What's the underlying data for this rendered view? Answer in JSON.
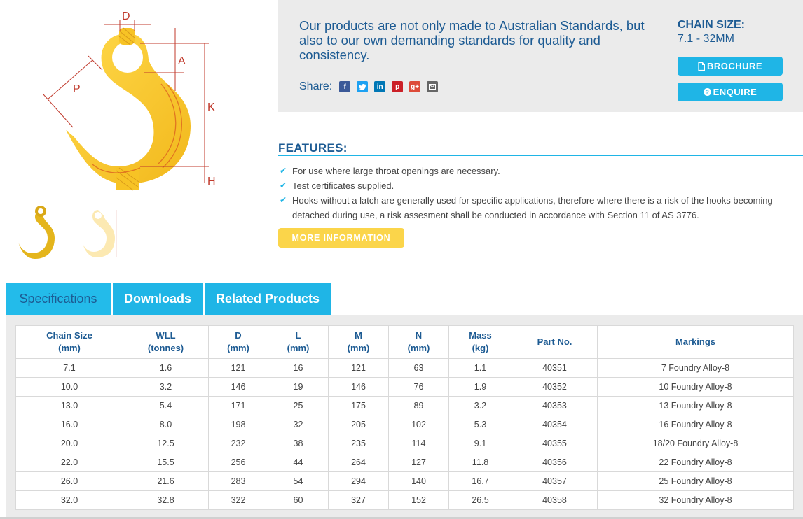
{
  "diagram": {
    "labels": {
      "d": "D",
      "a": "A",
      "p": "P",
      "k": "K",
      "h": "H"
    }
  },
  "info": {
    "intro": "Our products are not only made to Australian Standards, but also to our own demanding standards for quality and consistency.",
    "share_label": "Share:",
    "share_icons": [
      "facebook-icon",
      "twitter-icon",
      "linkedin-icon",
      "pinterest-icon",
      "google-plus-icon",
      "email-icon"
    ],
    "chain_size_title": "CHAIN SIZE:",
    "chain_size_value": "7.1 - 32MM",
    "brochure_label": "BROCHURE",
    "enquire_label": "ENQUIRE"
  },
  "features": {
    "title": "FEATURES:",
    "items": [
      "For use where large throat openings are necessary.",
      "Test certificates supplied.",
      "Hooks without a latch are generally used for specific applications, therefore where there is a risk of the hooks becoming detached during use, a risk assesment shall be conducted in accordance with Section 11 of AS 3776."
    ],
    "more_label": "MORE INFORMATION"
  },
  "tabs": [
    "Specifications",
    "Downloads",
    "Related Products"
  ],
  "table": {
    "headers": [
      [
        "Chain Size",
        "(mm)"
      ],
      [
        "WLL",
        "(tonnes)"
      ],
      [
        "D",
        "(mm)"
      ],
      [
        "L",
        "(mm)"
      ],
      [
        "M",
        "(mm)"
      ],
      [
        "N",
        "(mm)"
      ],
      [
        "Mass",
        "(kg)"
      ],
      [
        "Part No.",
        ""
      ],
      [
        "Markings",
        ""
      ]
    ],
    "rows": [
      [
        "7.1",
        "1.6",
        "121",
        "16",
        "121",
        "63",
        "1.1",
        "40351",
        "7 Foundry Alloy-8"
      ],
      [
        "10.0",
        "3.2",
        "146",
        "19",
        "146",
        "76",
        "1.9",
        "40352",
        "10 Foundry Alloy-8"
      ],
      [
        "13.0",
        "5.4",
        "171",
        "25",
        "175",
        "89",
        "3.2",
        "40353",
        "13 Foundry Alloy-8"
      ],
      [
        "16.0",
        "8.0",
        "198",
        "32",
        "205",
        "102",
        "5.3",
        "40354",
        "16 Foundry Alloy-8"
      ],
      [
        "20.0",
        "12.5",
        "232",
        "38",
        "235",
        "114",
        "9.1",
        "40355",
        "18/20 Foundry Alloy-8"
      ],
      [
        "22.0",
        "15.5",
        "256",
        "44",
        "264",
        "127",
        "11.8",
        "40356",
        "22 Foundry Alloy-8"
      ],
      [
        "26.0",
        "21.6",
        "283",
        "54",
        "294",
        "140",
        "16.7",
        "40357",
        "25 Foundry Alloy-8"
      ],
      [
        "32.0",
        "32.8",
        "322",
        "60",
        "327",
        "152",
        "26.5",
        "40358",
        "32 Foundry Alloy-8"
      ]
    ]
  },
  "colors": {
    "brand_blue": "#1d5b93",
    "accent_cyan": "#1fb5e6",
    "accent_yellow": "#fbd54a",
    "hook_yellow": "#f7c325",
    "panel_grey": "#ebebeb"
  }
}
